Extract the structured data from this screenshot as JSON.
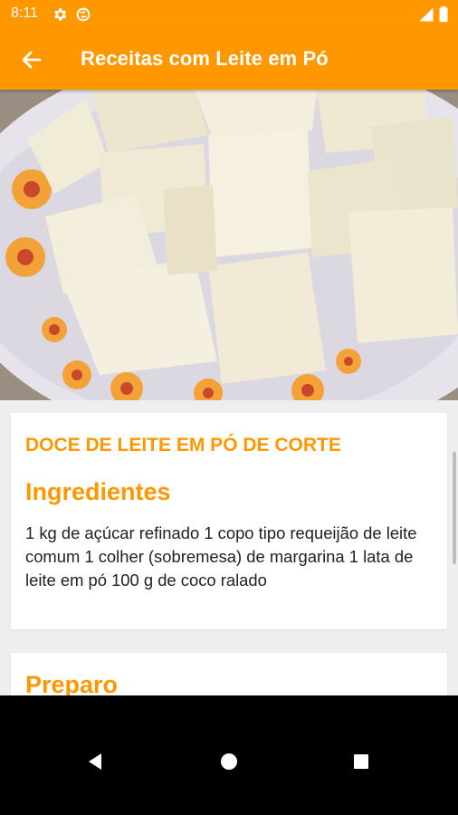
{
  "status_bar": {
    "time": "8:11",
    "icons": [
      "gear-icon",
      "sync-icon",
      "signal-icon",
      "battery-icon"
    ]
  },
  "toolbar": {
    "title": "Receitas com Leite em Pó",
    "back_icon": "arrow-back-icon"
  },
  "recipe": {
    "name": "DOCE DE LEITE EM PÓ DE CORTE",
    "ingredients_heading": "Ingredientes",
    "ingredients_text": " 1 kg de açúcar refinado 1 copo tipo requeijão de leite comum 1 colher (sobremesa) de margarina 1 lata de leite em pó 100 g de coco ralado",
    "preparation_heading": "Preparo"
  },
  "navigation": {
    "icons": [
      "back-triangle-icon",
      "home-circle-icon",
      "recents-square-icon"
    ]
  },
  "colors": {
    "accent": "#ff9800",
    "background": "#eeeeee",
    "card": "#ffffff",
    "nav_bar": "#000000"
  }
}
